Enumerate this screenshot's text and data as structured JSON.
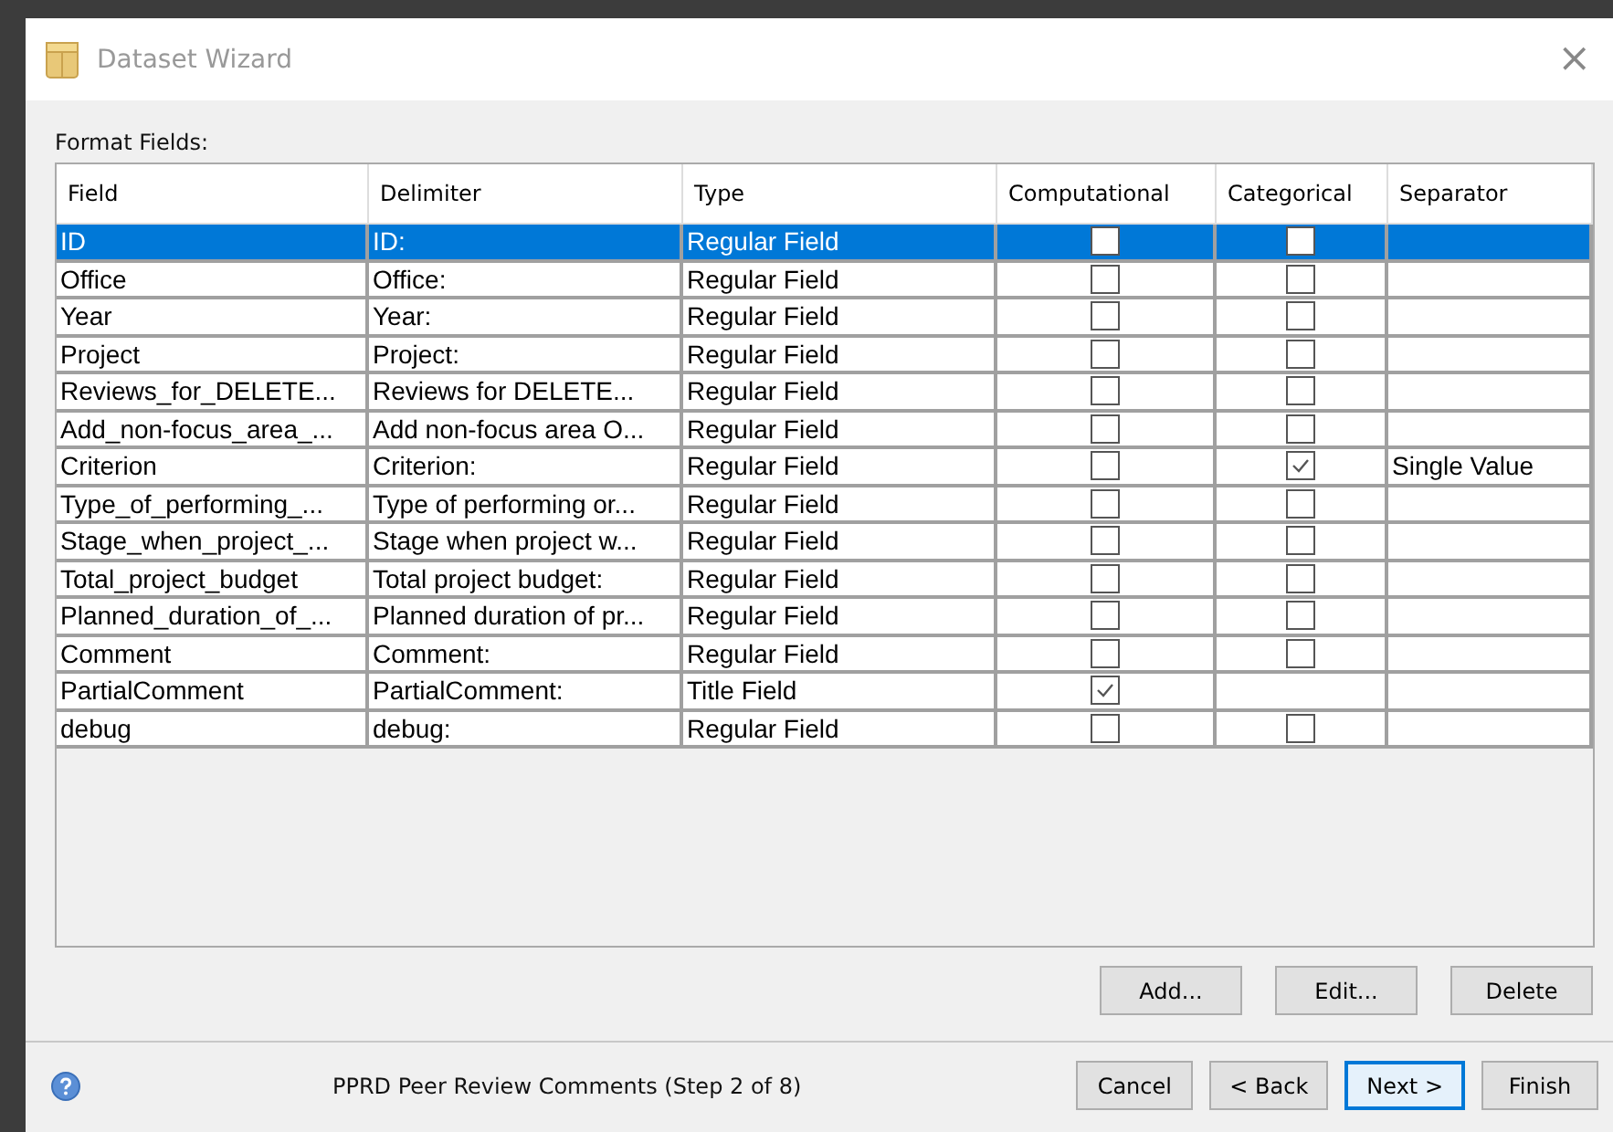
{
  "window": {
    "title": "Dataset Wizard",
    "close": "×"
  },
  "section_label": "Format Fields:",
  "table": {
    "columns": [
      "Field",
      "Delimiter",
      "Type",
      "Computational",
      "Categorical",
      "Separator"
    ],
    "rows": [
      {
        "field": "ID",
        "delimiter": "ID:",
        "type": "Regular Field",
        "computational": false,
        "categorical": false,
        "selected": true
      },
      {
        "field": "Office",
        "delimiter": "Office:",
        "type": "Regular Field",
        "computational": false,
        "categorical": false,
        "selected": false
      },
      {
        "field": "Year",
        "delimiter": "Year:",
        "type": "Regular Field",
        "computational": false,
        "categorical": false,
        "selected": false
      },
      {
        "field": "Project",
        "delimiter": "Project:",
        "type": "Regular Field",
        "computational": false,
        "categorical": false,
        "selected": false
      },
      {
        "field": "Reviews_for_DELETE...",
        "delimiter": "Reviews for DELETE...",
        "type": "Regular Field",
        "computational": false,
        "categorical": false,
        "selected": false
      },
      {
        "field": "Add_non-focus_area_...",
        "delimiter": "Add non-focus area O...",
        "type": "Regular Field",
        "computational": false,
        "categorical": false,
        "selected": false
      },
      {
        "field": "Criterion",
        "delimiter": "Criterion:",
        "type": "Regular Field",
        "computational": false,
        "categorical": true,
        "separator": "Single Value",
        "selected": false
      },
      {
        "field": "Type_of_performing_...",
        "delimiter": "Type of performing or...",
        "type": "Regular Field",
        "computational": false,
        "categorical": false,
        "selected": false
      },
      {
        "field": "Stage_when_project_...",
        "delimiter": "Stage when project w...",
        "type": "Regular Field",
        "computational": false,
        "categorical": false,
        "selected": false
      },
      {
        "field": "Total_project_budget",
        "delimiter": "Total project budget:",
        "type": "Regular Field",
        "computational": false,
        "categorical": false,
        "selected": false
      },
      {
        "field": "Planned_duration_of_...",
        "delimiter": "Planned duration of pr...",
        "type": "Regular Field",
        "computational": false,
        "categorical": false,
        "selected": false
      },
      {
        "field": "Comment",
        "delimiter": "Comment:",
        "type": "Regular Field",
        "computational": false,
        "categorical": false,
        "selected": false
      },
      {
        "field": "PartialComment",
        "delimiter": "PartialComment:",
        "type": "Title Field",
        "computational": true,
        "selected": false
      },
      {
        "field": "debug",
        "delimiter": "debug:",
        "type": "Regular Field",
        "computational": false,
        "categorical": false,
        "selected": false
      }
    ]
  },
  "table_buttons": [
    "Add...",
    "Edit...",
    "Delete"
  ],
  "footer": {
    "status": "PPRD Peer Review Comments (Step 2 of 8)",
    "buttons": [
      {
        "label": "Cancel",
        "default": false
      },
      {
        "label": "< Back",
        "default": false
      },
      {
        "label": "Next >",
        "default": true
      },
      {
        "label": "Finish",
        "default": false
      }
    ]
  }
}
